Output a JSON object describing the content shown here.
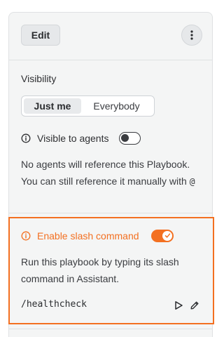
{
  "header": {
    "edit_label": "Edit",
    "more_icon": "more-vertical-icon"
  },
  "visibility": {
    "title": "Visibility",
    "options": [
      "Just me",
      "Everybody"
    ],
    "selected": "Just me"
  },
  "agents": {
    "label": "Visible to agents",
    "enabled": false,
    "description": "No agents will reference this Playbook. You can still reference it manually with",
    "mention_symbol": "@",
    "icon": "info-icon"
  },
  "slash_command": {
    "label": "Enable slash command",
    "enabled": true,
    "description": "Run this playbook by typing its slash command in Assistant.",
    "command": "/healthcheck",
    "icon": "info-icon",
    "actions": [
      "play-icon",
      "edit-pencil-icon"
    ]
  },
  "colors": {
    "accent": "#f37021",
    "panel_bg": "#f4f5f5",
    "border": "#dfe1e3",
    "text": "#2f3033"
  }
}
